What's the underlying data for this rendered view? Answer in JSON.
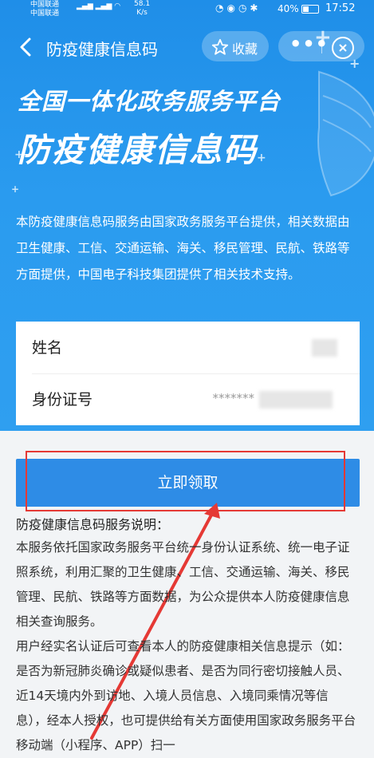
{
  "status_bar": {
    "carrier1": "中国联通",
    "carrier2": "中国联通",
    "speed_value": "58.1",
    "speed_unit": "K/s",
    "battery": "40%",
    "time": "17:52"
  },
  "nav": {
    "title": "防疫健康信息码",
    "favorite_label": "收藏"
  },
  "banner": {
    "line1": "全国一体化政务服务平台",
    "line2": "防疫健康信息码"
  },
  "intro": "本防疫健康信息码服务由国家政务服务平台提供，相关数据由卫生健康、工信、交通运输、海关、移民管理、民航、铁路等方面提供，中国电子科技集团提供了相关技术支持。",
  "form": {
    "name_label": "姓名",
    "id_label": "身份证号",
    "id_value": "*******"
  },
  "claim_button": "立即领取",
  "description": {
    "title": "防疫健康信息码服务说明：",
    "para1": "本服务依托国家政务服务平台统一身份认证系统、统一电子证照系统，利用汇聚的卫生健康、工信、交通运输、海关、移民管理、民航、铁路等方面数据，为公众提供本人防疫健康信息相关查询服务。",
    "para2": "用户经实名认证后可查看本人的防疫健康相关信息提示（如：是否为新冠肺炎确诊或疑似患者、是否为同行密切接触人员、近14天境内外到访地、入境人员信息、入境同乘情况等信息），经本人授权，也可提供给有关方面使用国家政务服务平台移动端（小程序、APP）扫一"
  },
  "colors": {
    "hero_blue": "#1f8ee8",
    "button_blue": "#2e8ce6",
    "annotation_red": "#e53935"
  }
}
